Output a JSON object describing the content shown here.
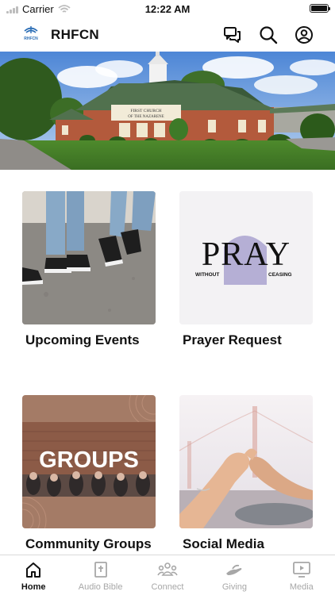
{
  "status_bar": {
    "carrier": "Carrier",
    "time": "12:22 AM"
  },
  "header": {
    "title": "RHFCN",
    "logo_caption": "RHFCN",
    "icons": [
      "chat-icon",
      "search-icon",
      "account-icon"
    ]
  },
  "hero": {
    "sign_line1": "FIRST CHURCH",
    "sign_line2": "OF THE NAZARENE"
  },
  "cards": [
    {
      "label": "Upcoming Events"
    },
    {
      "label": "Prayer Request",
      "art_title": "PRAY",
      "art_left": "WITHOUT",
      "art_right": "CEASING"
    },
    {
      "label": "Community Groups",
      "art_title": "GROUPS"
    },
    {
      "label": "Social Media"
    }
  ],
  "tabs": [
    {
      "label": "Home",
      "icon": "home-icon",
      "active": true
    },
    {
      "label": "Audio Bible",
      "icon": "bible-icon",
      "active": false
    },
    {
      "label": "Connect",
      "icon": "people-icon",
      "active": false
    },
    {
      "label": "Giving",
      "icon": "giving-hand-icon",
      "active": false
    },
    {
      "label": "Media",
      "icon": "media-play-icon",
      "active": false
    }
  ],
  "colors": {
    "accent": "#111111",
    "inactive": "#a7a7a7",
    "groups_brown": "#a47b66",
    "logo_blue": "#2a6db5"
  }
}
